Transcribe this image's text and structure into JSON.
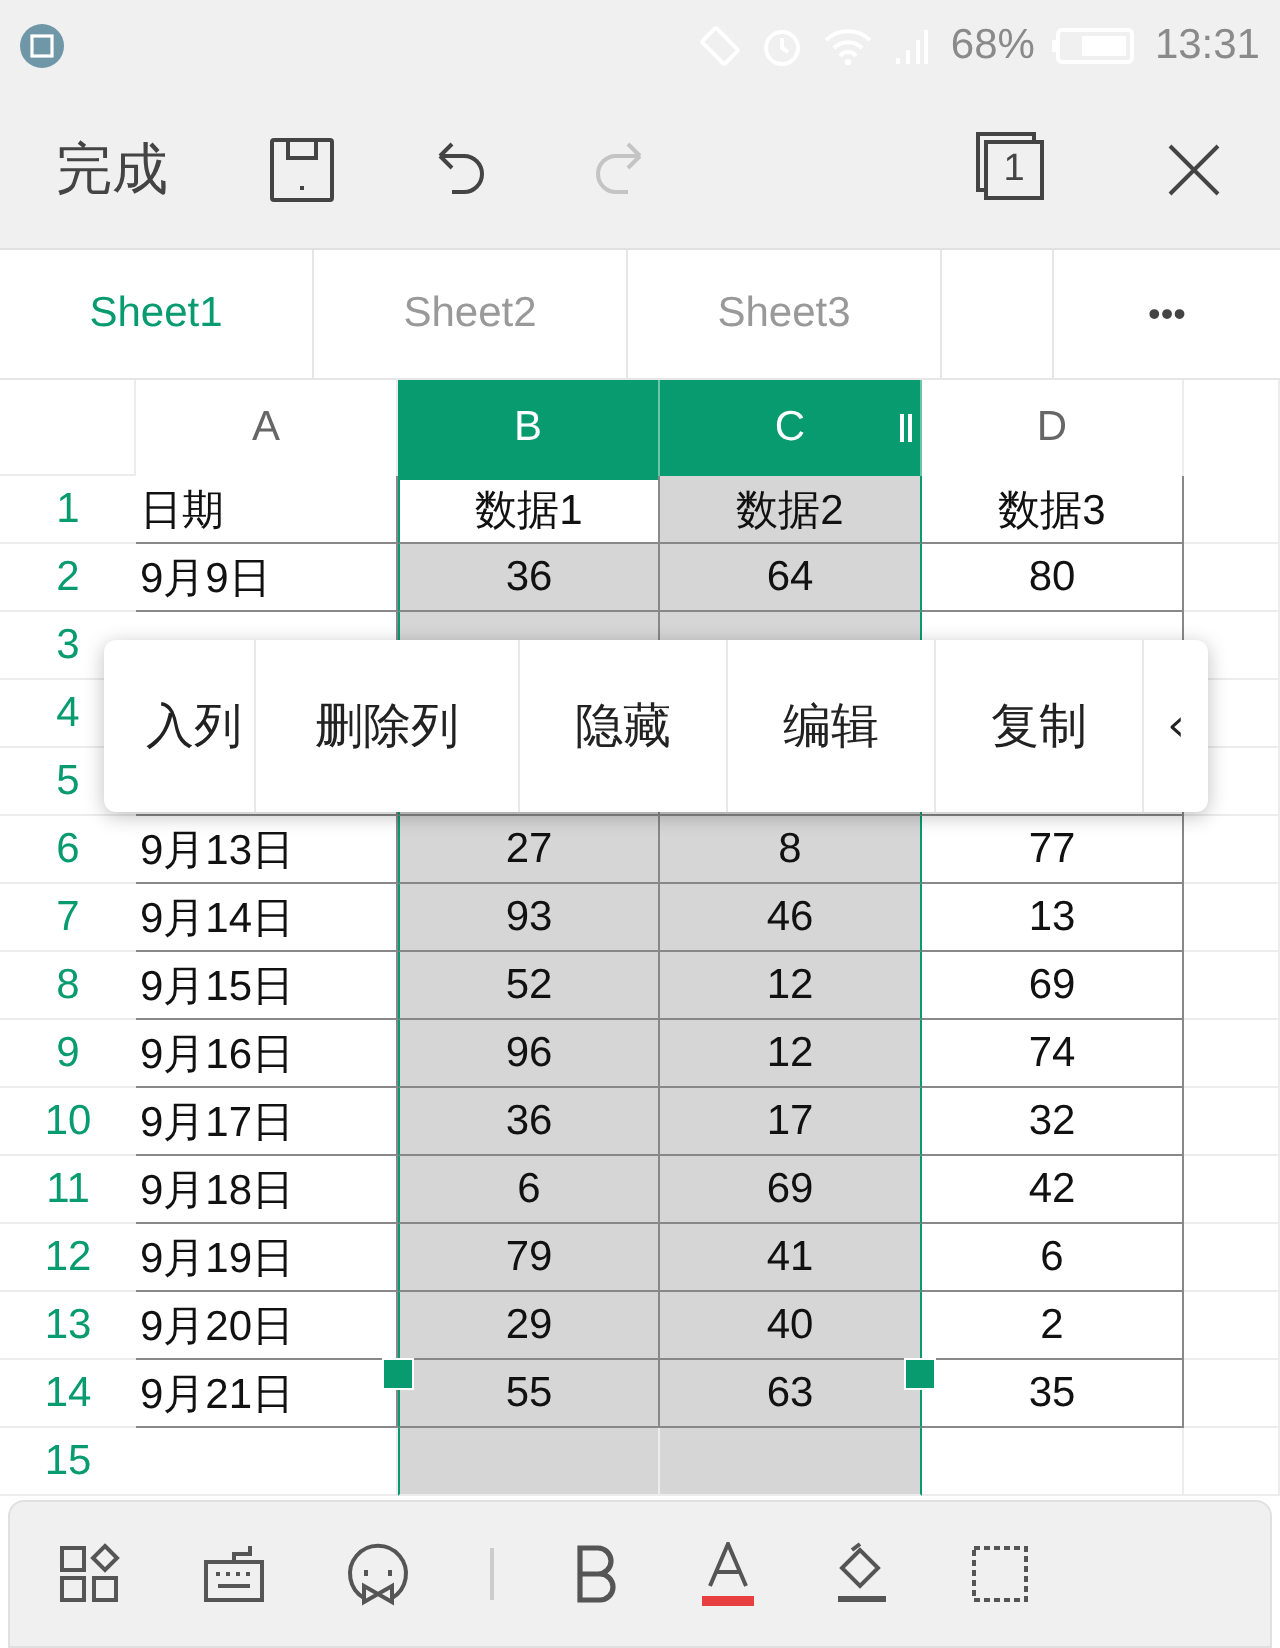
{
  "status_bar": {
    "battery": "68%",
    "time": "13:31"
  },
  "toolbar": {
    "done": "完成",
    "redo_disabled": true,
    "window_count": "1"
  },
  "sheet_tabs": [
    {
      "label": "Sheet1",
      "selected": true
    },
    {
      "label": "Sheet2",
      "selected": false
    },
    {
      "label": "Sheet3",
      "selected": false
    }
  ],
  "more": "•••",
  "columns": [
    {
      "label": "A",
      "selected": false
    },
    {
      "label": "B",
      "selected": true
    },
    {
      "label": "C",
      "selected": true
    },
    {
      "label": "D",
      "selected": false
    }
  ],
  "rows": [
    {
      "number": "1",
      "cells": [
        "日期",
        "数据1",
        "数据2",
        "数据3"
      ],
      "active": [
        false,
        true,
        false,
        false
      ]
    },
    {
      "number": "2",
      "cells": [
        "9月9日",
        "36",
        "64",
        "80"
      ]
    },
    {
      "number": "3",
      "cells": []
    },
    {
      "number": "4",
      "cells": [],
      "covered": true
    },
    {
      "number": "5",
      "cells": []
    },
    {
      "number": "6",
      "cells": [
        "9月13日",
        "27",
        "8",
        "77"
      ]
    },
    {
      "number": "7",
      "cells": [
        "9月14日",
        "93",
        "46",
        "13"
      ]
    },
    {
      "number": "8",
      "cells": [
        "9月15日",
        "52",
        "12",
        "69"
      ]
    },
    {
      "number": "9",
      "cells": [
        "9月16日",
        "96",
        "12",
        "74"
      ]
    },
    {
      "number": "10",
      "cells": [
        "9月17日",
        "36",
        "17",
        "32"
      ]
    },
    {
      "number": "11",
      "cells": [
        "9月18日",
        "6",
        "69",
        "42"
      ]
    },
    {
      "number": "12",
      "cells": [
        "9月19日",
        "79",
        "41",
        "6"
      ]
    },
    {
      "number": "13",
      "cells": [
        "9月20日",
        "29",
        "40",
        "2"
      ]
    },
    {
      "number": "14",
      "cells": [
        "9月21日",
        "55",
        "63",
        "35"
      ]
    },
    {
      "number": "15",
      "cells": []
    }
  ],
  "context_menu": [
    "入列",
    "删除列",
    "隐藏",
    "编辑",
    "复制",
    "‹"
  ]
}
